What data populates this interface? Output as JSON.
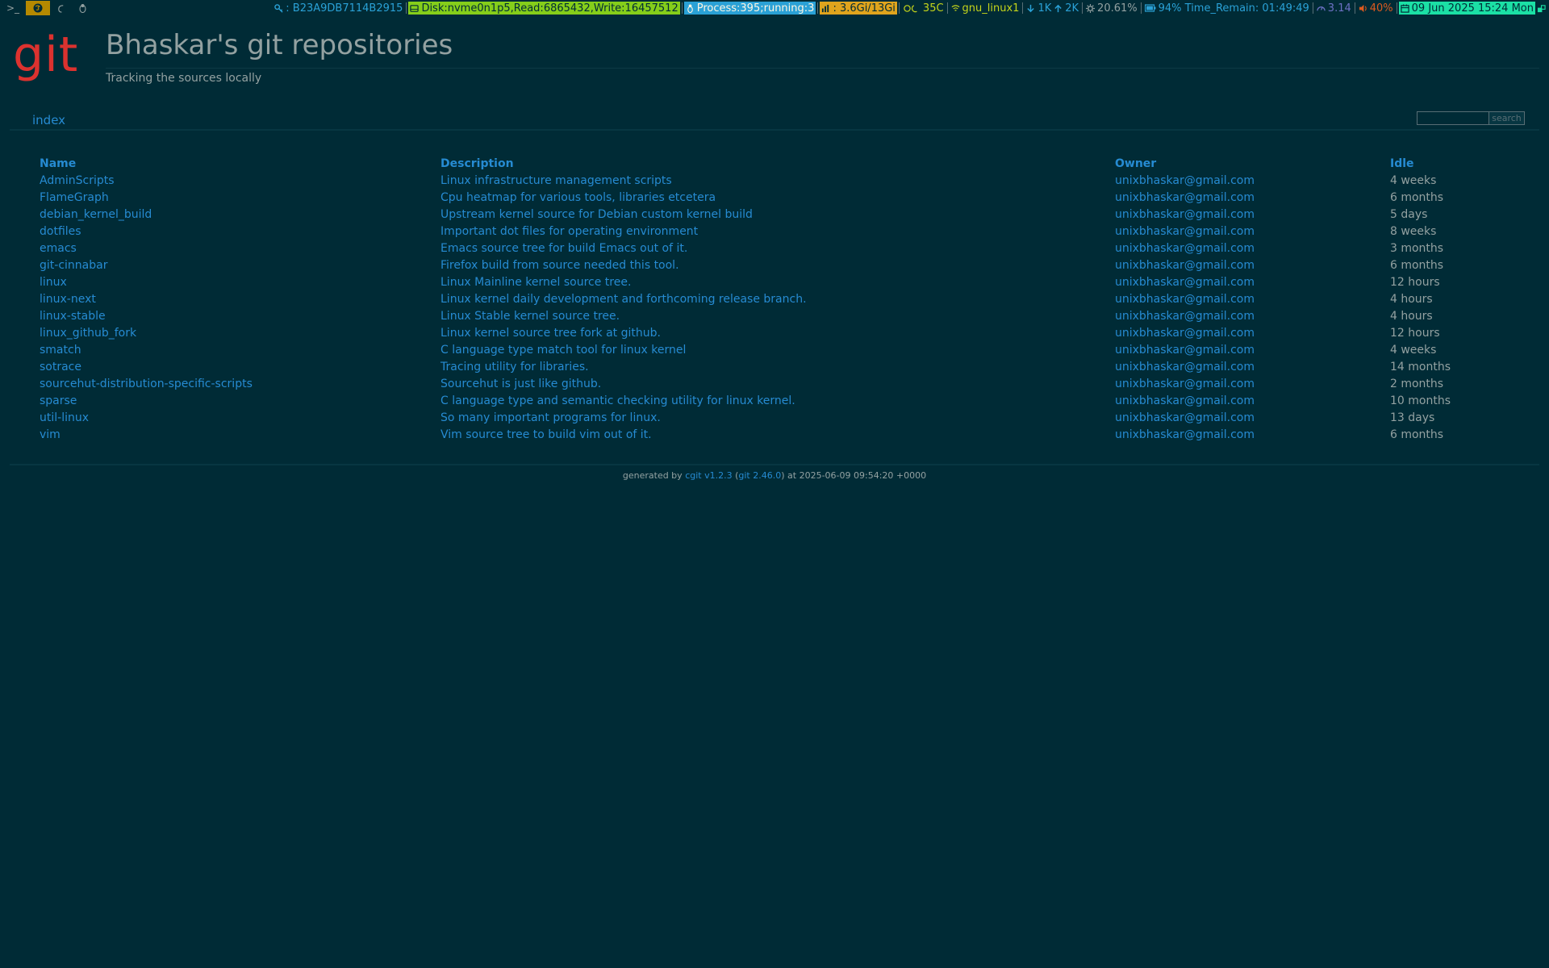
{
  "topbar": {
    "workspaces": [
      {
        "label": ">_",
        "icon": "terminal-icon",
        "active": false
      },
      {
        "label": "",
        "icon": "emacs-icon",
        "active": true
      },
      {
        "label": "",
        "icon": "firefox-icon",
        "active": false
      },
      {
        "label": "",
        "icon": "tux-icon",
        "active": false
      }
    ],
    "key": ": B23A9DB7114B2915",
    "disk": "Disk:nvme0n1p5,Read:6865432,Write:16457512",
    "process": "Process:395;running:3",
    "memory": ": 3.6Gi/13Gi",
    "temp": "35C",
    "wifi": "gnu_linux1",
    "net_down": "1K",
    "net_up": "2K",
    "cpu": "20.61%",
    "battery": "94% Time_Remain: 01:49:49",
    "load": "3.14",
    "volume": "40%",
    "date": "09 Jun 2025 15:24 Mon",
    "colors": {
      "bg": "#002b36",
      "disk_bg": "#85ce1a",
      "process_bg": "#2aa1d6",
      "memory_bg": "#e0a41d",
      "date_bg": "#1be0a5",
      "cyan": "#00bcd4",
      "yellow": "#c5d51a",
      "orange": "#dc5a1f",
      "violet": "#6c71c4"
    }
  },
  "header": {
    "logo_text": "git",
    "title": "Bhaskar's git repositories",
    "subtitle": "Tracking the sources locally"
  },
  "tabs": {
    "index_label": "index",
    "search_placeholder": "",
    "search_button": "search"
  },
  "table": {
    "headers": {
      "name": "Name",
      "description": "Description",
      "owner": "Owner",
      "idle": "Idle"
    },
    "rows": [
      {
        "name": "AdminScripts",
        "description": "Linux infrastructure management scripts",
        "owner": "unixbhaskar@gmail.com",
        "idle": "4 weeks"
      },
      {
        "name": "FlameGraph",
        "description": "Cpu heatmap for various tools, libraries etcetera",
        "owner": "unixbhaskar@gmail.com",
        "idle": "6 months"
      },
      {
        "name": "debian_kernel_build",
        "description": "Upstream kernel source for Debian custom kernel build",
        "owner": "unixbhaskar@gmail.com",
        "idle": "5 days"
      },
      {
        "name": "dotfiles",
        "description": "Important dot files for operating environment",
        "owner": "unixbhaskar@gmail.com",
        "idle": "8 weeks"
      },
      {
        "name": "emacs",
        "description": "Emacs source tree for build Emacs out of it.",
        "owner": "unixbhaskar@gmail.com",
        "idle": "3 months"
      },
      {
        "name": "git-cinnabar",
        "description": "Firefox build from source needed this tool.",
        "owner": "unixbhaskar@gmail.com",
        "idle": "6 months"
      },
      {
        "name": "linux",
        "description": "Linux Mainline kernel source tree.",
        "owner": "unixbhaskar@gmail.com",
        "idle": "12 hours"
      },
      {
        "name": "linux-next",
        "description": "Linux kernel daily development and forthcoming release branch.",
        "owner": "unixbhaskar@gmail.com",
        "idle": "4 hours"
      },
      {
        "name": "linux-stable",
        "description": "Linux Stable kernel source tree.",
        "owner": "unixbhaskar@gmail.com",
        "idle": "4 hours"
      },
      {
        "name": "linux_github_fork",
        "description": "Linux kernel source tree fork at github.",
        "owner": "unixbhaskar@gmail.com",
        "idle": "12 hours"
      },
      {
        "name": "smatch",
        "description": "C language type match tool for linux kernel",
        "owner": "unixbhaskar@gmail.com",
        "idle": "4 weeks"
      },
      {
        "name": "sotrace",
        "description": "Tracing utility for libraries.",
        "owner": "unixbhaskar@gmail.com",
        "idle": "14 months"
      },
      {
        "name": "sourcehut-distribution-specific-scripts",
        "description": "Sourcehut is just like github.",
        "owner": "unixbhaskar@gmail.com",
        "idle": "2 months"
      },
      {
        "name": "sparse",
        "description": "C language type and semantic checking utility for linux kernel.",
        "owner": "unixbhaskar@gmail.com",
        "idle": "10 months"
      },
      {
        "name": "util-linux",
        "description": "So many important programs for linux.",
        "owner": "unixbhaskar@gmail.com",
        "idle": "13 days"
      },
      {
        "name": "vim",
        "description": "Vim source tree to build vim out of it.",
        "owner": "unixbhaskar@gmail.com",
        "idle": "6 months"
      }
    ]
  },
  "footer": {
    "prefix": "generated by ",
    "cgit_link": "cgit v1.2.3",
    "open_paren": " (",
    "git_link": "git 2.46.0",
    "suffix": ") at 2025-06-09 09:54:20 +0000"
  },
  "colors": {
    "background": "#002b36",
    "link": "#268bd2",
    "text": "#93a1a1",
    "logo": "#dc322f"
  }
}
